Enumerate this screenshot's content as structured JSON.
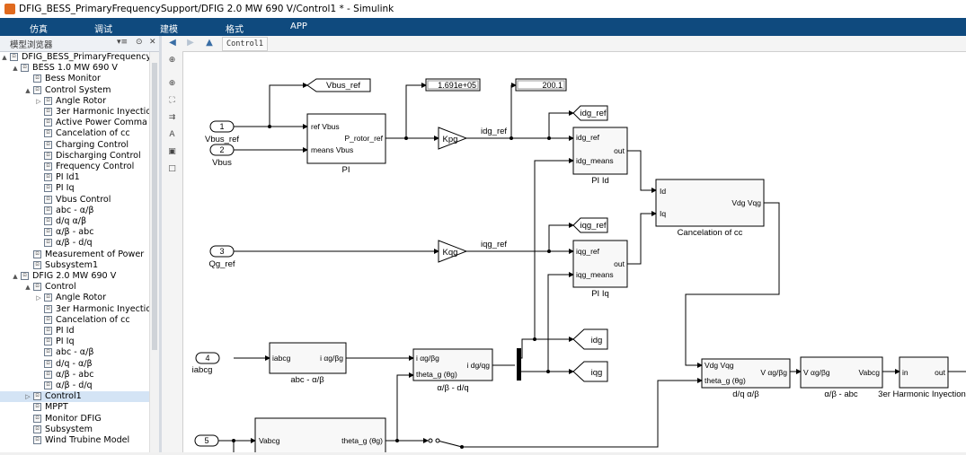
{
  "window": {
    "title": "DFIG_BESS_PrimaryFrequencySupport/DFIG  2.0 MW 690 V/Control1 * - Simulink"
  },
  "menu": [
    "仿真",
    "调试",
    "建模",
    "格式",
    "APP"
  ],
  "browser": {
    "title": "模型浏览器"
  },
  "tree": [
    {
      "label": "DFIG_BESS_PrimaryFrequencySu",
      "indent": 0,
      "toggle": "▲"
    },
    {
      "label": "BESS 1.0 MW 690 V",
      "indent": 1,
      "toggle": "▲"
    },
    {
      "label": "Bess Monitor",
      "indent": 2,
      "toggle": ""
    },
    {
      "label": "Control System",
      "indent": 2,
      "toggle": "▲"
    },
    {
      "label": "Angle Rotor",
      "indent": 3,
      "toggle": "▷"
    },
    {
      "label": "3er Harmonic Inyectio",
      "indent": 3,
      "toggle": ""
    },
    {
      "label": "Active Power Comma",
      "indent": 3,
      "toggle": ""
    },
    {
      "label": "Cancelation of cc",
      "indent": 3,
      "toggle": ""
    },
    {
      "label": "Charging Control",
      "indent": 3,
      "toggle": ""
    },
    {
      "label": "Discharging Control",
      "indent": 3,
      "toggle": ""
    },
    {
      "label": "Frequency Control",
      "indent": 3,
      "toggle": ""
    },
    {
      "label": "PI Id1",
      "indent": 3,
      "toggle": ""
    },
    {
      "label": "PI Iq",
      "indent": 3,
      "toggle": ""
    },
    {
      "label": "Vbus Control",
      "indent": 3,
      "toggle": ""
    },
    {
      "label": "abc - α/β",
      "indent": 3,
      "toggle": ""
    },
    {
      "label": "d/q  α/β",
      "indent": 3,
      "toggle": ""
    },
    {
      "label": "α/β - abc",
      "indent": 3,
      "toggle": ""
    },
    {
      "label": "α/β - d/q",
      "indent": 3,
      "toggle": ""
    },
    {
      "label": "Measurement of  Power",
      "indent": 2,
      "toggle": ""
    },
    {
      "label": "Subsystem1",
      "indent": 2,
      "toggle": ""
    },
    {
      "label": "DFIG  2.0 MW 690 V",
      "indent": 1,
      "toggle": "▲"
    },
    {
      "label": "Control",
      "indent": 2,
      "toggle": "▲"
    },
    {
      "label": "Angle Rotor",
      "indent": 3,
      "toggle": "▷"
    },
    {
      "label": "3er Harmonic Inyectio",
      "indent": 3,
      "toggle": ""
    },
    {
      "label": "Cancelation of cc",
      "indent": 3,
      "toggle": ""
    },
    {
      "label": "PI Id",
      "indent": 3,
      "toggle": ""
    },
    {
      "label": "PI Iq",
      "indent": 3,
      "toggle": ""
    },
    {
      "label": "abc - α/β",
      "indent": 3,
      "toggle": ""
    },
    {
      "label": "d/q - α/β",
      "indent": 3,
      "toggle": ""
    },
    {
      "label": "α/β - abc",
      "indent": 3,
      "toggle": ""
    },
    {
      "label": "α/β - d/q",
      "indent": 3,
      "toggle": ""
    },
    {
      "label": "Control1",
      "indent": 2,
      "toggle": "▷",
      "selected": true
    },
    {
      "label": "MPPT",
      "indent": 2,
      "toggle": ""
    },
    {
      "label": "Monitor DFIG",
      "indent": 2,
      "toggle": ""
    },
    {
      "label": "Subsystem",
      "indent": 2,
      "toggle": ""
    },
    {
      "label": "Wind Trubine Model",
      "indent": 2,
      "toggle": ""
    }
  ],
  "breadcrumb": "Control1",
  "diagram": {
    "inports": [
      {
        "num": "1",
        "name": "Vbus_ref"
      },
      {
        "num": "2",
        "name": "Vbus"
      },
      {
        "num": "3",
        "name": "Qg_ref"
      },
      {
        "num": "4",
        "name": "iabcg"
      },
      {
        "num": "5",
        "name": "Vabcg"
      }
    ],
    "gotos": {
      "vbus_ref": "Vbus_ref",
      "idg_ref": "idg_ref",
      "iqg_ref": "iqg_ref",
      "idg": "idg",
      "iqg": "iqg"
    },
    "displays": {
      "d1": "1.691e+05",
      "d2": "200.1"
    },
    "gains": {
      "kpg": "Kpg",
      "kqg": "Kqg"
    },
    "signals": {
      "idg_ref": "idg_ref",
      "iqg_ref": "iqg_ref"
    },
    "blocks": {
      "pi": {
        "name": "PI",
        "in1": "ref Vbus",
        "in2": "means Vbus",
        "out": "P_rotor_ref"
      },
      "pi_id": {
        "name": "PI Id",
        "in1": "idg_ref",
        "in2": "idg_means",
        "out": "out"
      },
      "pi_iq": {
        "name": "PI Iq",
        "in1": "iqg_ref",
        "in2": "iqg_means",
        "out": "out"
      },
      "cancel": {
        "name": "Cancelation of cc",
        "in1": "Id",
        "in2": "Iq",
        "out": "Vdg  Vqg"
      },
      "abc_ab": {
        "name": "abc - α/β",
        "in": "iabcg",
        "out": "i αg/βg"
      },
      "ab_dq": {
        "name": "α/β - d/q",
        "in1": "i αg/βg",
        "in2": "theta_g (θg)",
        "out": "i dg/qg"
      },
      "dq_ab": {
        "name": "d/q  α/β",
        "in1": "Vdg  Vqg",
        "in2": "theta_g (θg)",
        "out": "V αg/βg"
      },
      "ab_abc": {
        "name": "α/β - abc",
        "in": "V αg/βg",
        "out": "Vabcg"
      },
      "harm": {
        "name": "3er Harmonic Inyection",
        "in": "in",
        "out": "out"
      },
      "angle": {
        "in": "Vabcg",
        "out": "theta_g (θg)"
      }
    }
  }
}
